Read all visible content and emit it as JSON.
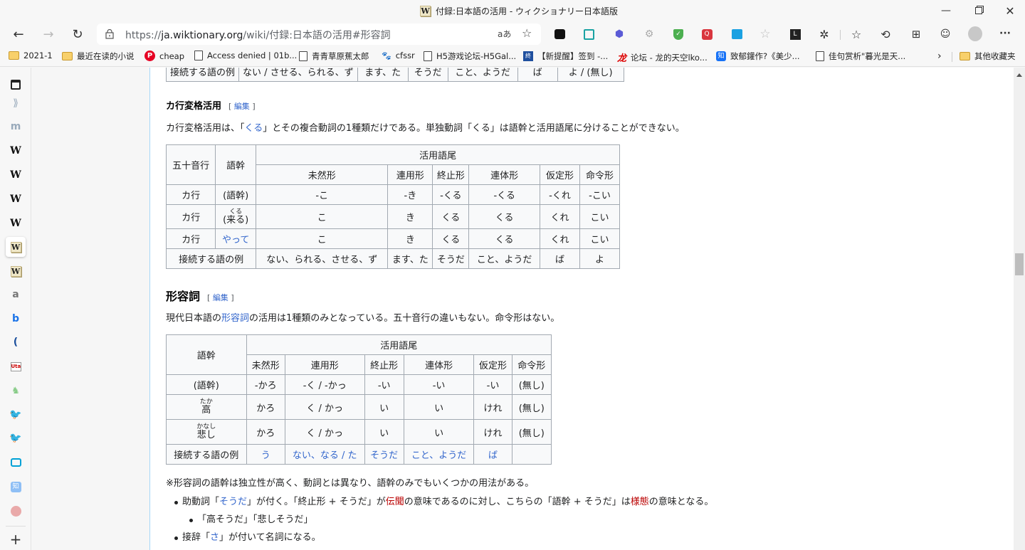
{
  "window": {
    "title": "付録:日本語の活用 - ウィクショナリー日本語版",
    "minimize_icon": "minimize-icon",
    "restore_icon": "restore-icon",
    "close_icon": "close-icon"
  },
  "toolbar": {
    "url_prefix": "https://",
    "url_domain": "ja.wiktionary.org",
    "url_path": "/wiki/付録:日本語の活用#形容詞",
    "read_aloud": "aあ",
    "more": "···"
  },
  "bookmarks": [
    {
      "label": "2021-1",
      "icon": "folder-icon"
    },
    {
      "label": "最近在读的小说",
      "icon": "folder-icon"
    },
    {
      "label": "cheap",
      "icon": "pinterest-icon"
    },
    {
      "label": "Access denied | 01b...",
      "icon": "page-icon"
    },
    {
      "label": "青青草原蕉太郎",
      "icon": "page-icon"
    },
    {
      "label": "cfssr",
      "icon": "cat-icon"
    },
    {
      "label": "H5游戏论坛-H5Gal...",
      "icon": "page-icon"
    },
    {
      "label": "【新提醒】签到 -...",
      "icon": "site-icon"
    },
    {
      "label": "论坛 - 龙的天空lko...",
      "icon": "dragon-icon"
    },
    {
      "label": "致郁鑵作?《美少...",
      "icon": "zhihu-icon"
    },
    {
      "label": "佳句赏析\"暮光是天...",
      "icon": "page-icon"
    },
    {
      "label": "其他收藏夹",
      "icon": "folder-icon"
    }
  ],
  "prev_table_last_row": [
    "接続する語の例",
    "ない / させる、られる、ず",
    "ます、た",
    "そうだ",
    "こと、ようだ",
    "ば",
    "よ / (無し)"
  ],
  "kahen": {
    "heading": "カ行変格活用",
    "edit_open": "[",
    "edit_label": "編集",
    "edit_close": "]",
    "desc_pre": "カ行変格活用は、「",
    "desc_link": "くる",
    "desc_post": "」とその複合動詞の1種類だけである。単独動詞「くる」は語幹と活用語尾に分けることができない。",
    "table": {
      "h_gojuon": "五十音行",
      "h_gokan": "語幹",
      "h_gobi": "活用語尾",
      "forms": [
        "未然形",
        "連用形",
        "終止形",
        "連体形",
        "仮定形",
        "命令形"
      ],
      "rows": [
        {
          "gyo": "カ行",
          "gokan": "(語幹)",
          "cells": [
            "-こ",
            "-き",
            "-くる",
            "-くる",
            "-くれ",
            "-こい"
          ]
        },
        {
          "gyo": "カ行",
          "gokan_ruby": "くる",
          "gokan": "(来る)",
          "cells": [
            "こ",
            "き",
            "くる",
            "くる",
            "くれ",
            "こい"
          ]
        },
        {
          "gyo": "カ行",
          "gokan": "やって",
          "cells": [
            "こ",
            "き",
            "くる",
            "くる",
            "くれ",
            "こい"
          ]
        }
      ],
      "example_label": "接続する語の例",
      "examples": [
        "ない、られる、させる、ず",
        "ます、た",
        "そうだ",
        "こと、ようだ",
        "ば",
        "よ"
      ]
    }
  },
  "keiyoushi": {
    "heading": "形容詞",
    "edit_open": "[",
    "edit_label": "編集",
    "edit_close": "]",
    "desc_pre": "現代日本語の",
    "desc_link": "形容詞",
    "desc_post": "の活用は1種類のみとなっている。五十音行の違いもない。命令形はない。",
    "table": {
      "h_gokan": "語幹",
      "h_gobi": "活用語尾",
      "forms": [
        "未然形",
        "連用形",
        "終止形",
        "連体形",
        "仮定形",
        "命令形"
      ],
      "rows": [
        {
          "gokan": "(語幹)",
          "cells": [
            "-かろ",
            "-く / -かっ",
            "-い",
            "-い",
            "-い",
            "(無し)"
          ]
        },
        {
          "gokan_ruby": "たか",
          "gokan": "高",
          "cells": [
            "かろ",
            "く / かっ",
            "い",
            "い",
            "けれ",
            "(無し)"
          ]
        },
        {
          "gokan_ruby": "かなし",
          "gokan": "悲し",
          "cells": [
            "かろ",
            "く / かっ",
            "い",
            "い",
            "けれ",
            "(無し)"
          ]
        }
      ],
      "example_label": "接続する語の例",
      "examples": [
        "う",
        "ない、なる / た",
        "そうだ",
        "こと、ようだ",
        "ば",
        ""
      ]
    },
    "note": "※形容詞の語幹は独立性が高く、動詞とは異なり、語幹のみでもいくつかの用法がある。",
    "bullets": {
      "b1_pre": "助動詞「",
      "b1_link": "そうだ",
      "b1_mid": "」が付く。「終止形 + そうだ」が",
      "b1_red1": "伝聞",
      "b1_mid2": "の意味であるのに対し、こちらの「語幹 + そうだ」は",
      "b1_red2": "様態",
      "b1_post": "の意味となる。",
      "b1_sub": "「高そうだ」「悲しそうだ」",
      "b2_pre": "接辞「",
      "b2_link": "さ",
      "b2_post": "」が付いて名詞になる。"
    }
  },
  "sidebar_icons": [
    "wiki-icon-outline",
    "stack-icon",
    "mi-icon",
    "wikipedia-icon",
    "wikipedia-icon",
    "wikipedia-icon",
    "wikipedia-icon",
    "wiktionary-icon",
    "wiktionary-icon",
    "amazon-icon",
    "bing-icon",
    "c-icon",
    "uta-icon",
    "mascot-icon",
    "twitter-icon",
    "twitter-icon",
    "bilibili-icon",
    "zhihu-icon",
    "sailboat-icon",
    "add-icon"
  ],
  "scroll": {
    "position_fraction": 0.39
  }
}
